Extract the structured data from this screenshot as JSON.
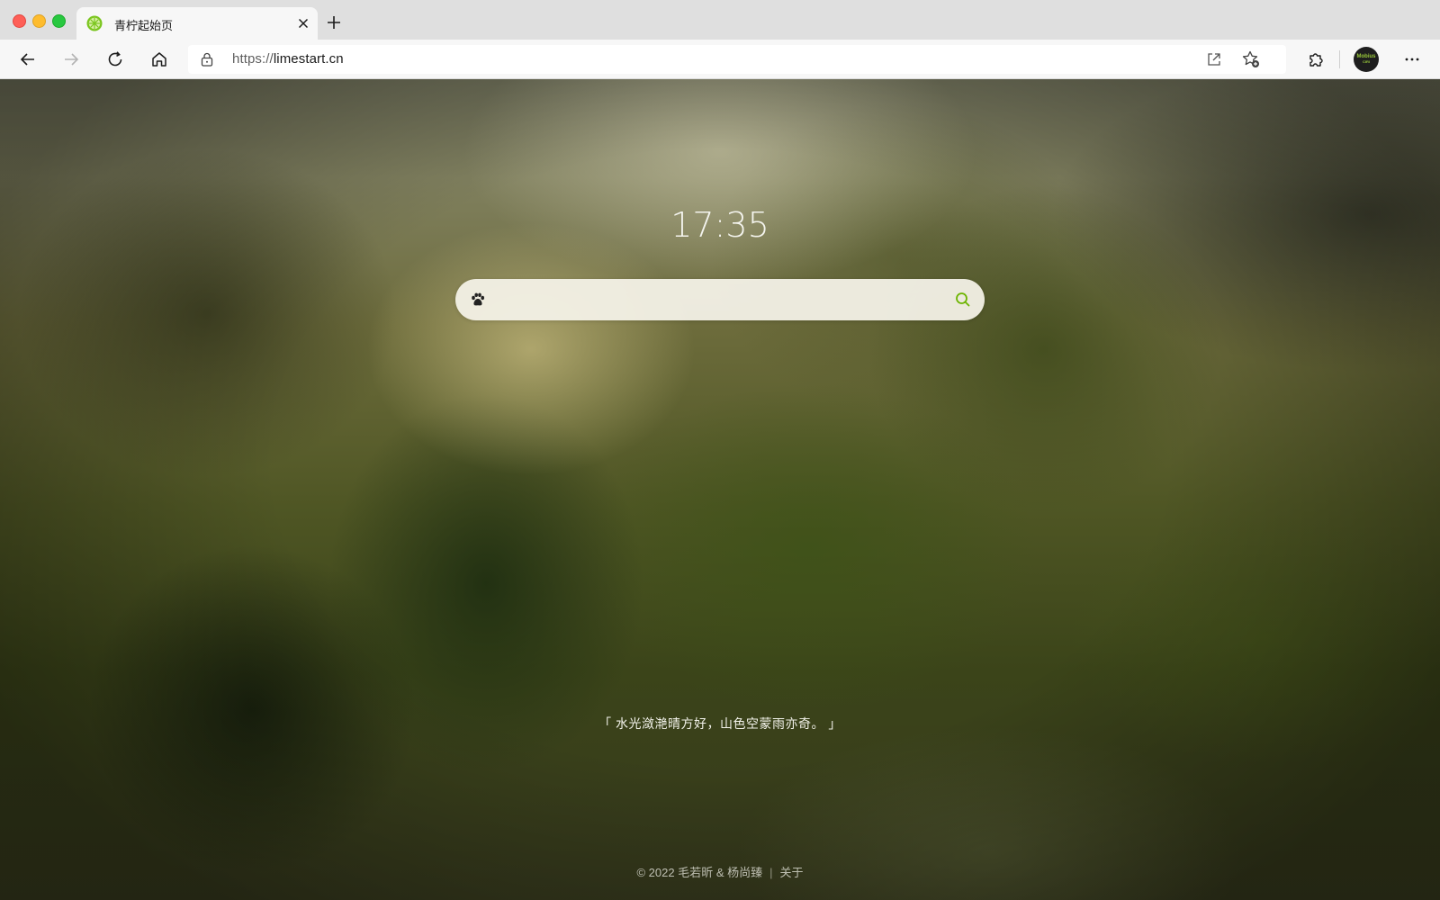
{
  "window": {
    "tab_title": "青柠起始页"
  },
  "toolbar": {
    "url_prefix": "https://",
    "url_host": "limestart.cn",
    "profile_label": "Mobius",
    "profile_sub": "CIRI"
  },
  "page": {
    "clock": "17:35",
    "search_placeholder": "",
    "quote": "「 水光潋滟晴方好，山色空蒙雨亦奇。 」",
    "footer_copyright": "© 2022 毛若昕 & 杨尚臻",
    "footer_separator": "|",
    "footer_about": "关于"
  },
  "colors": {
    "accent": "#6cb400",
    "favicon": "#7ac51e"
  }
}
